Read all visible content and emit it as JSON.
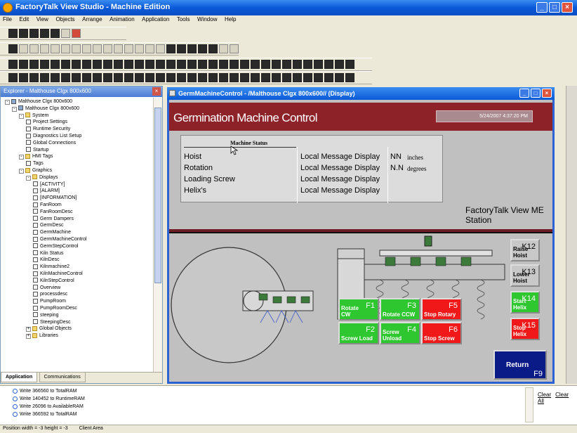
{
  "window": {
    "title": "FactoryTalk View Studio - Machine Edition"
  },
  "menu": [
    "File",
    "Edit",
    "View",
    "Objects",
    "Arrange",
    "Animation",
    "Application",
    "Tools",
    "Window",
    "Help"
  ],
  "explorer": {
    "title": "Explorer - Malthouse Clgx 800x600",
    "tree": [
      {
        "label": "Malthouse Clgx 800x600",
        "depth": 0,
        "icon": "pc",
        "exp": "-"
      },
      {
        "label": "Malthouse Clgx 800x600",
        "depth": 1,
        "icon": "app",
        "exp": "-"
      },
      {
        "label": "System",
        "depth": 2,
        "icon": "folder",
        "exp": "-"
      },
      {
        "label": "Project Settings",
        "depth": 3,
        "icon": "file"
      },
      {
        "label": "Runtime Security",
        "depth": 3,
        "icon": "file"
      },
      {
        "label": "Diagnostics List Setup",
        "depth": 3,
        "icon": "file"
      },
      {
        "label": "Global Connections",
        "depth": 3,
        "icon": "file"
      },
      {
        "label": "Startup",
        "depth": 3,
        "icon": "file"
      },
      {
        "label": "HMI Tags",
        "depth": 2,
        "icon": "folder",
        "exp": "-"
      },
      {
        "label": "Tags",
        "depth": 3,
        "icon": "file"
      },
      {
        "label": "Graphics",
        "depth": 2,
        "icon": "folder",
        "exp": "-"
      },
      {
        "label": "Displays",
        "depth": 3,
        "icon": "folder",
        "exp": "-"
      },
      {
        "label": "[ACTIVITY]",
        "depth": 4,
        "icon": "file"
      },
      {
        "label": "[ALARM]",
        "depth": 4,
        "icon": "file"
      },
      {
        "label": "[INFORMATION]",
        "depth": 4,
        "icon": "file"
      },
      {
        "label": "FanRoom",
        "depth": 4,
        "icon": "file"
      },
      {
        "label": "FanRoomDesc",
        "depth": 4,
        "icon": "file"
      },
      {
        "label": "Germ Dampers",
        "depth": 4,
        "icon": "file"
      },
      {
        "label": "GermDesc",
        "depth": 4,
        "icon": "file"
      },
      {
        "label": "GermMachine",
        "depth": 4,
        "icon": "file"
      },
      {
        "label": "GermMachineControl",
        "depth": 4,
        "icon": "file"
      },
      {
        "label": "GermStepControl",
        "depth": 4,
        "icon": "file"
      },
      {
        "label": "Kiln Status",
        "depth": 4,
        "icon": "file"
      },
      {
        "label": "KilnDesc",
        "depth": 4,
        "icon": "file"
      },
      {
        "label": "Kilnmachine2",
        "depth": 4,
        "icon": "file"
      },
      {
        "label": "KilnMachineControl",
        "depth": 4,
        "icon": "file"
      },
      {
        "label": "KilnStepControl",
        "depth": 4,
        "icon": "file"
      },
      {
        "label": "Overview",
        "depth": 4,
        "icon": "file"
      },
      {
        "label": "processdesc",
        "depth": 4,
        "icon": "file"
      },
      {
        "label": "PumpRoom",
        "depth": 4,
        "icon": "file"
      },
      {
        "label": "PumpRoomDesc",
        "depth": 4,
        "icon": "file"
      },
      {
        "label": "steeping",
        "depth": 4,
        "icon": "file"
      },
      {
        "label": "SteepingDesc",
        "depth": 4,
        "icon": "file"
      },
      {
        "label": "Global Objects",
        "depth": 3,
        "icon": "folder",
        "exp": "+"
      },
      {
        "label": "Libraries",
        "depth": 3,
        "icon": "folder",
        "exp": "+"
      }
    ],
    "tabs": [
      "Application",
      "Communications"
    ]
  },
  "display": {
    "title": "GermMachineControl - /Malthouse Clgx 800x600// (Display)",
    "header_title": "Germination Machine Control",
    "datetime": "5/24/2007 4:37:20 PM",
    "status_title": "Machine Status",
    "rows": [
      {
        "label": "Hoist",
        "message": "Local Message Display",
        "value": "NN",
        "unit": "inches"
      },
      {
        "label": "Rotation",
        "message": "Local Message Display",
        "value": "N.N",
        "unit": "degrees"
      },
      {
        "label": "Loading Screw",
        "message": "Local Message Display",
        "value": "",
        "unit": ""
      },
      {
        "label": "Helix's",
        "message": "Local Message Display",
        "value": "",
        "unit": ""
      }
    ],
    "station_label_1": "FactoryTalk View ME",
    "station_label_2": "Station",
    "buttons": {
      "f1": {
        "key": "F1",
        "l1": "Rotate",
        "l2": "CW"
      },
      "f3": {
        "key": "F3",
        "l1": "",
        "l2": "Rotate CCW"
      },
      "f5": {
        "key": "F5",
        "l1": "",
        "l2": "Stop Rotary"
      },
      "f2": {
        "key": "F2",
        "l1": "",
        "l2": "Screw Load"
      },
      "f4": {
        "key": "F4",
        "l1": "Screw",
        "l2": "Unload"
      },
      "f6": {
        "key": "F6",
        "l1": "",
        "l2": "Stop Screw"
      },
      "k12": {
        "key": "K12",
        "l1": "",
        "l2": "Raise Hoist"
      },
      "k13": {
        "key": "K13",
        "l1": "",
        "l2": "Lower Hoist"
      },
      "k14": {
        "key": "K14",
        "l1": "Start",
        "l2": "Helix"
      },
      "k15": {
        "key": "K15",
        "l1": "Stop",
        "l2": "Helix"
      },
      "f9": {
        "key": "F9",
        "l1": "Return",
        "l2": ""
      }
    }
  },
  "output": {
    "lines": [
      "Write 366560 to TotalRAM",
      "Write 140452 to RuntimeRAM",
      "Write 26096 to AvailableRAM",
      "Write 366592 to TotalRAM"
    ],
    "clear": "Clear",
    "clear_all": "Clear All"
  },
  "statusbar": {
    "position": "Position width = -3  height = -3",
    "area": "Client Area"
  },
  "colors": {
    "header_red": "#8d2229",
    "green": "#2fc72f",
    "red": "#f01818",
    "navy": "#0a1a86"
  }
}
